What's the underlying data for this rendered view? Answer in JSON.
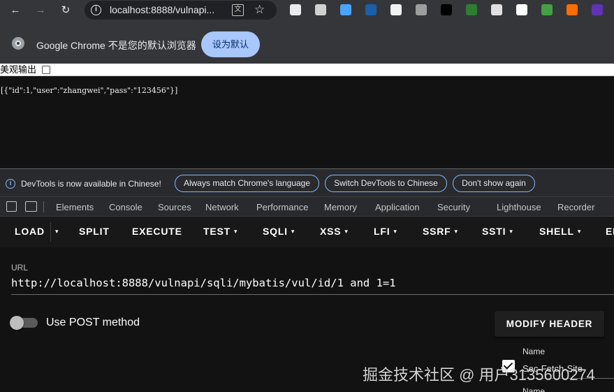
{
  "browser": {
    "url": "localhost:8888/vulnapi...",
    "nav": {
      "back": "←",
      "forward": "→",
      "reload": "↻",
      "info": "i",
      "star": "☆",
      "translate": "文"
    }
  },
  "extensions": [
    {
      "name": "flask-extension-icon",
      "color": "#e8eaed"
    },
    {
      "name": "window-extension-icon",
      "color": "#d0d0d0"
    },
    {
      "name": "pin-extension-icon",
      "color": "#4aa3ff"
    },
    {
      "name": "wave-extension-icon",
      "color": "#1a5fa8"
    },
    {
      "name": "hacker-extension-icon",
      "color": "#f1f1f1"
    },
    {
      "name": "hat-extension-icon",
      "color": "#9e9e9e"
    },
    {
      "name": "hackbar-extension-icon",
      "color": "#000000"
    },
    {
      "name": "circle-extension-icon",
      "color": "#2e7d32"
    },
    {
      "name": "ring-extension-icon",
      "color": "#e0e0e0"
    },
    {
      "name": "cloud-extension-icon",
      "color": "#ffffff"
    },
    {
      "name": "badge-green-extension-icon",
      "color": "#43a047"
    },
    {
      "name": "orange-extension-icon",
      "color": "#ff6d00"
    },
    {
      "name": "purple-extension-icon",
      "color": "#5e35b1"
    }
  ],
  "default_bar": {
    "message": "Google Chrome 不是您的默认浏览器",
    "button": "设为默认"
  },
  "page": {
    "pretty_label": "美观输出",
    "json_output": "[{\"id\":1,\"user\":\"zhangwei\",\"pass\":\"123456\"}]"
  },
  "devtools": {
    "notice": "DevTools is now available in Chinese!",
    "notice_buttons": [
      "Always match Chrome's language",
      "Switch DevTools to Chinese",
      "Don't show again"
    ],
    "tabs": [
      "Elements",
      "Console",
      "Sources",
      "Network",
      "Performance",
      "Memory",
      "Application",
      "Security",
      "Lighthouse",
      "Recorder"
    ]
  },
  "hackbar": {
    "menu": [
      {
        "label": "LOAD",
        "caret": false
      },
      {
        "label": "SPLIT",
        "caret": false
      },
      {
        "label": "EXECUTE",
        "caret": false
      },
      {
        "label": "TEST",
        "caret": true
      },
      {
        "label": "SQLI",
        "caret": true
      },
      {
        "label": "XSS",
        "caret": true
      },
      {
        "label": "LFI",
        "caret": true
      },
      {
        "label": "SSRF",
        "caret": true
      },
      {
        "label": "SSTI",
        "caret": true
      },
      {
        "label": "SHELL",
        "caret": true
      },
      {
        "label": "EN",
        "caret": false
      }
    ],
    "caret_symbol": "▾",
    "load_dropdown": "▾",
    "url_label": "URL",
    "url_value": "http://localhost:8888/vulnapi/sqli/mybatis/vul/id/1 and 1=1",
    "post_label": "Use POST method",
    "post_enabled": false,
    "modify_header": "MODIFY HEADER",
    "header_name_label": "Name",
    "header_name_value": "Sec-Fetch-Site",
    "header_name_label_2": "Name"
  },
  "watermark": "掘金技术社区 @ 用户3135600274"
}
